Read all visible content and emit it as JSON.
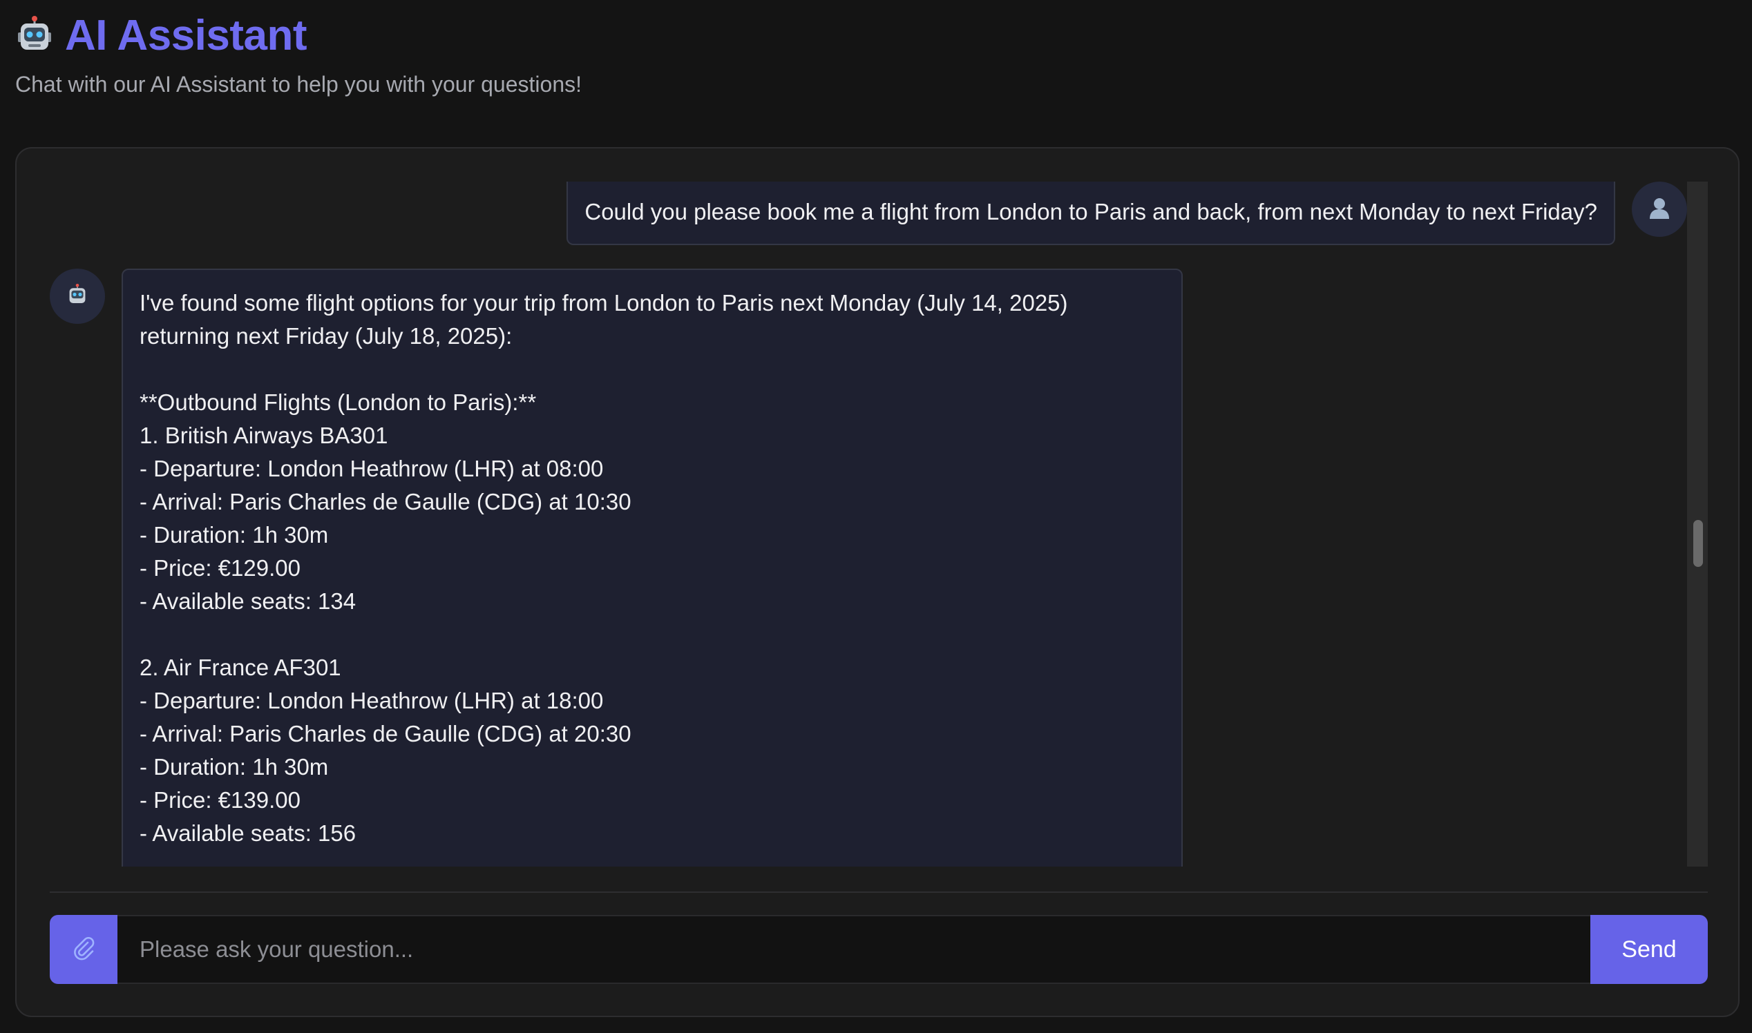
{
  "header": {
    "title": "AI Assistant",
    "subtitle": "Chat with our AI Assistant to help you with your questions!",
    "icon": "robot-icon"
  },
  "chat": {
    "messages": [
      {
        "role": "user",
        "avatar_icon": "user-icon",
        "text": "Could you please book me a flight from London to Paris and back, from next Monday to next Friday?"
      },
      {
        "role": "assistant",
        "avatar_icon": "robot-icon",
        "text": "I've found some flight options for your trip from London to Paris next Monday (July 14, 2025)\nreturning next Friday (July 18, 2025):\n\n**Outbound Flights (London to Paris):**\n1. British Airways BA301\n- Departure: London Heathrow (LHR) at 08:00\n- Arrival: Paris Charles de Gaulle (CDG) at 10:30\n- Duration: 1h 30m\n- Price: €129.00\n- Available seats: 134\n\n2. Air France AF301\n- Departure: London Heathrow (LHR) at 18:00\n- Arrival: Paris Charles de Gaulle (CDG) at 20:30\n- Duration: 1h 30m\n- Price: €139.00\n- Available seats: 156"
      }
    ]
  },
  "composer": {
    "attach_icon": "paperclip-icon",
    "placeholder": "Please ask your question...",
    "value": "",
    "send_label": "Send"
  },
  "colors": {
    "accent": "#6663e8",
    "title": "#6f6cf0",
    "background": "#141414",
    "bubble": "#1e2030"
  }
}
